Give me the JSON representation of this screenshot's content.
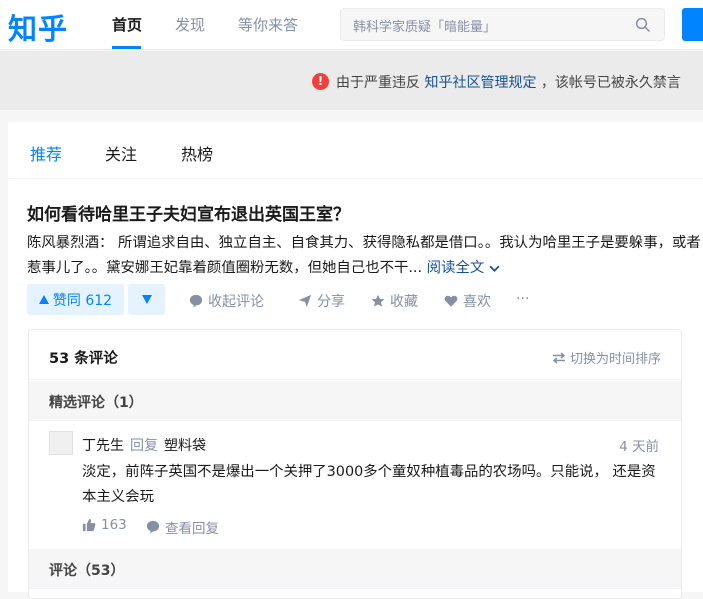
{
  "header": {
    "logo": "知乎",
    "nav": [
      "首页",
      "发现",
      "等你来答"
    ],
    "search_placeholder": "韩科学家质疑「暗能量」",
    "accent_color": "#0084ff"
  },
  "ban_notice": {
    "prefix": "由于严重违反 ",
    "link": "知乎社区管理规定",
    "suffix": " ，该帐号已被永久禁言"
  },
  "tabs": [
    "推荐",
    "关注",
    "热榜"
  ],
  "question": {
    "title": "如何看待哈里王子夫妇宣布退出英国王室？",
    "author": "陈风暴烈酒：",
    "excerpt": " 所谓追求自由、独立自主、自食其力、获得隐私都是借口。。我认为哈里王子是要躲事，或者惹事儿了。。黛安娜王妃靠着颜值圈粉无数，但她自己也不干...",
    "read_more": "阅读全文"
  },
  "actions": {
    "vote_up": "赞同 612",
    "comment": "收起评论",
    "share": "分享",
    "collect": "收藏",
    "like": "喜欢",
    "more": "···"
  },
  "comments": {
    "count_label": "53 条评论",
    "sort_label": "切换为时间排序",
    "featured_head": "精选评论（1）",
    "all_head": "评论（53）",
    "item": {
      "author": "丁先生",
      "reply_word": "回复",
      "reply_to": "塑料袋",
      "time": "4 天前",
      "text": "淡定，前阵子英国不是爆出一个关押了3000多个童奴种植毒品的农场吗。只能说， 还是资本主义会玩",
      "likes": "163",
      "view_replies": "查看回复"
    }
  }
}
